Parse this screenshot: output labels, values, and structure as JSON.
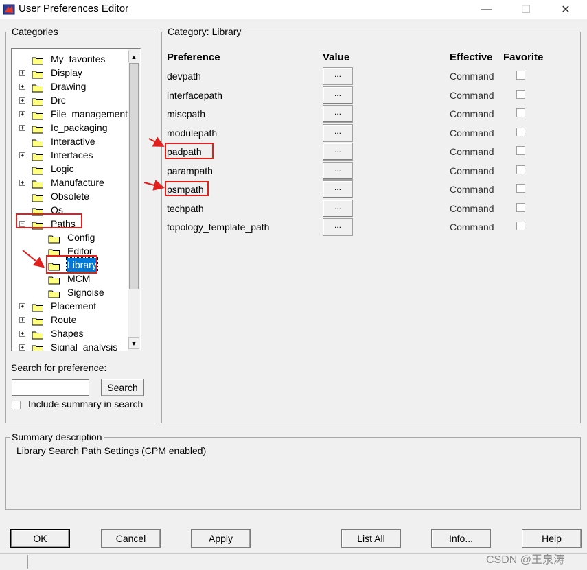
{
  "window": {
    "title": "User Preferences Editor",
    "minimize": "—",
    "maximize": "☐",
    "close": "✕"
  },
  "categories": {
    "legend": "Categories",
    "tree": [
      {
        "label": "My_favorites",
        "level": 0,
        "expander": ""
      },
      {
        "label": "Display",
        "level": 0,
        "expander": "+"
      },
      {
        "label": "Drawing",
        "level": 0,
        "expander": "+"
      },
      {
        "label": "Drc",
        "level": 0,
        "expander": "+"
      },
      {
        "label": "File_management",
        "level": 0,
        "expander": "+"
      },
      {
        "label": "Ic_packaging",
        "level": 0,
        "expander": "+"
      },
      {
        "label": "Interactive",
        "level": 0,
        "expander": ""
      },
      {
        "label": "Interfaces",
        "level": 0,
        "expander": "+"
      },
      {
        "label": "Logic",
        "level": 0,
        "expander": ""
      },
      {
        "label": "Manufacture",
        "level": 0,
        "expander": "+"
      },
      {
        "label": "Obsolete",
        "level": 0,
        "expander": ""
      },
      {
        "label": "Os",
        "level": 0,
        "expander": ""
      },
      {
        "label": "Paths",
        "level": 0,
        "expander": "−"
      },
      {
        "label": "Config",
        "level": 1,
        "expander": ""
      },
      {
        "label": "Editor",
        "level": 1,
        "expander": ""
      },
      {
        "label": "Library",
        "level": 1,
        "expander": "",
        "selected": true
      },
      {
        "label": "MCM",
        "level": 1,
        "expander": ""
      },
      {
        "label": "Signoise",
        "level": 1,
        "expander": ""
      },
      {
        "label": "Placement",
        "level": 0,
        "expander": "+"
      },
      {
        "label": "Route",
        "level": 0,
        "expander": "+"
      },
      {
        "label": "Shapes",
        "level": 0,
        "expander": "+"
      },
      {
        "label": "Signal_analysis",
        "level": 0,
        "expander": "+"
      }
    ],
    "search_label": "Search for preference:",
    "search_value": "",
    "search_button": "Search",
    "include_summary_label": "Include summary in search"
  },
  "category_panel": {
    "legend_prefix": "Category:",
    "legend_value": "Library",
    "headers": {
      "preference": "Preference",
      "value": "Value",
      "effective": "Effective",
      "favorite": "Favorite"
    },
    "rows": [
      {
        "name": "devpath",
        "value_btn": "...",
        "effective": "Command"
      },
      {
        "name": "interfacepath",
        "value_btn": "...",
        "effective": "Command"
      },
      {
        "name": "miscpath",
        "value_btn": "...",
        "effective": "Command"
      },
      {
        "name": "modulepath",
        "value_btn": "...",
        "effective": "Command"
      },
      {
        "name": "padpath",
        "value_btn": "...",
        "effective": "Command"
      },
      {
        "name": "parampath",
        "value_btn": "...",
        "effective": "Command"
      },
      {
        "name": "psmpath",
        "value_btn": "...",
        "effective": "Command"
      },
      {
        "name": "techpath",
        "value_btn": "...",
        "effective": "Command"
      },
      {
        "name": "topology_template_path",
        "value_btn": "...",
        "effective": "Command"
      }
    ]
  },
  "summary": {
    "legend": "Summary description",
    "text": "Library Search Path Settings (CPM enabled)"
  },
  "buttons": {
    "ok": "OK",
    "cancel": "Cancel",
    "apply": "Apply",
    "list_all": "List All",
    "info": "Info...",
    "help": "Help"
  },
  "watermark": "CSDN @王泉涛",
  "colors": {
    "highlight": "#e0201c",
    "selection": "#0078d7",
    "folder": "#ffff80"
  }
}
